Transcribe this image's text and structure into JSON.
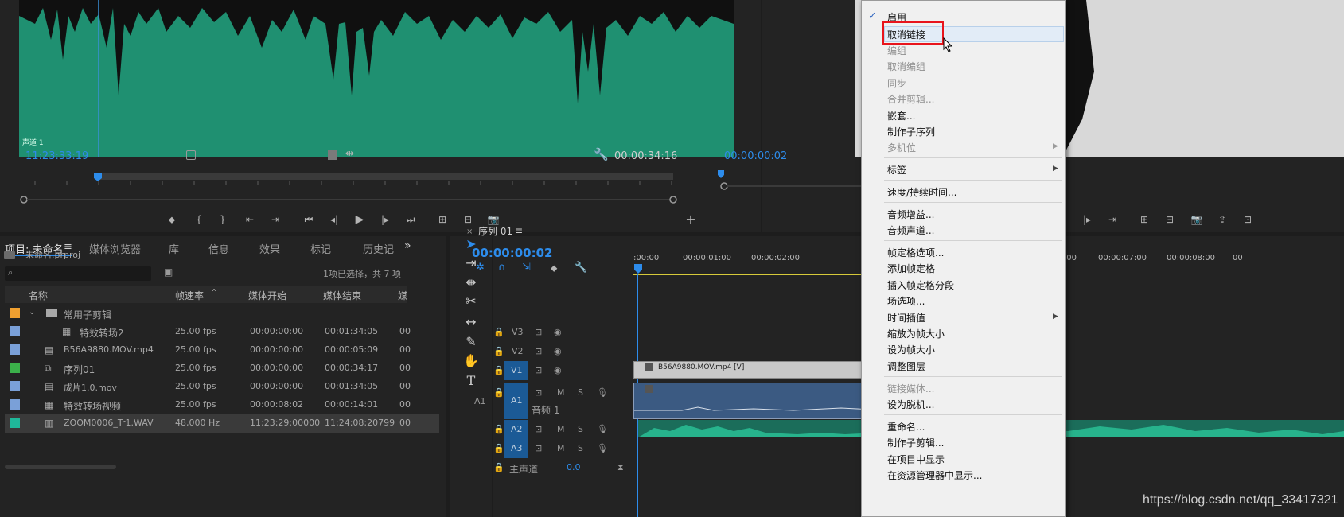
{
  "source_monitor": {
    "channel_label": "声道 1",
    "timecode_in": "11:23:33:19",
    "timecode_duration": "00:00:34:16"
  },
  "program_monitor": {
    "timecode": "00:00:00:02"
  },
  "project_panel": {
    "tabs": [
      "项目: 未命名",
      "媒体浏览器",
      "库",
      "信息",
      "效果",
      "标记",
      "历史记"
    ],
    "project_file": "未命名.prproj",
    "selection_info": "1项已选择，共 7 项",
    "search_placeholder": "",
    "columns": [
      "名称",
      "帧速率",
      "媒体开始",
      "媒体结束",
      "媒"
    ],
    "items": [
      {
        "name": "常用子剪辑",
        "fps": "",
        "start": "",
        "end": "",
        "color": "#f0a030",
        "kind": "folder"
      },
      {
        "name": "特效转场2",
        "fps": "25.00 fps",
        "start": "00:00:00:00",
        "end": "00:01:34:05",
        "color": "#7aa0d8",
        "kind": "clip"
      },
      {
        "name": "B56A9880.MOV.mp4",
        "fps": "25.00 fps",
        "start": "00:00:00:00",
        "end": "00:00:05:09",
        "color": "#7aa0d8",
        "kind": "video"
      },
      {
        "name": "序列01",
        "fps": "25.00 fps",
        "start": "00:00:00:00",
        "end": "00:00:34:17",
        "color": "#3bb04a",
        "kind": "sequence"
      },
      {
        "name": "成片1.0.mov",
        "fps": "25.00 fps",
        "start": "00:00:00:00",
        "end": "00:01:34:05",
        "color": "#7aa0d8",
        "kind": "video"
      },
      {
        "name": "特效转场视频",
        "fps": "25.00 fps",
        "start": "00:00:08:02",
        "end": "00:00:14:01",
        "color": "#7aa0d8",
        "kind": "clip"
      },
      {
        "name": "ZOOM0006_Tr1.WAV",
        "fps": "48,000 Hz",
        "start": "11:23:29:00000",
        "end": "11:24:08:20799",
        "color": "#1fb89a",
        "kind": "audio"
      }
    ],
    "last_col_tail": "00"
  },
  "timeline": {
    "sequence_name": "序列 01",
    "timecode": "00:00:00:02",
    "ruler_labels": [
      ":00:00",
      "00:00:01:00",
      "00:00:02:00",
      "00",
      "00:00:06:00",
      "00:00:07:00",
      "00:00:08:00",
      "00"
    ],
    "tracks": [
      {
        "id": "V3",
        "source": ""
      },
      {
        "id": "V2",
        "source": ""
      },
      {
        "id": "V1",
        "source": ""
      },
      {
        "id": "A1",
        "source": "A1",
        "name": "音频 1"
      },
      {
        "id": "A2",
        "source": ""
      },
      {
        "id": "A3",
        "source": ""
      }
    ],
    "master_label": "主声道",
    "master_value": "0.0",
    "clip_video_label": "B56A9880.MOV.mp4 [V]",
    "mute_label": "M",
    "solo_label": "S"
  },
  "context_menu": {
    "items": [
      {
        "label": "启用",
        "checked": true,
        "disabled": false
      },
      {
        "label": "取消链接",
        "disabled": false,
        "highlighted": true
      },
      {
        "label": "编组",
        "disabled": true
      },
      {
        "label": "取消编组",
        "disabled": true
      },
      {
        "label": "同步",
        "disabled": true
      },
      {
        "label": "合并剪辑...",
        "disabled": true
      },
      {
        "label": "嵌套...",
        "disabled": false
      },
      {
        "label": "制作子序列",
        "disabled": false
      },
      {
        "label": "多机位",
        "disabled": true,
        "submenu": true
      },
      {
        "label": "标签",
        "disabled": false,
        "submenu": true,
        "sep_before": true
      },
      {
        "label": "速度/持续时间...",
        "disabled": false,
        "sep_before": true
      },
      {
        "label": "音频增益...",
        "disabled": false,
        "sep_before": true
      },
      {
        "label": "音频声道...",
        "disabled": false
      },
      {
        "label": "帧定格选项...",
        "disabled": false,
        "sep_before": true
      },
      {
        "label": "添加帧定格",
        "disabled": false
      },
      {
        "label": "插入帧定格分段",
        "disabled": false
      },
      {
        "label": "场选项...",
        "disabled": false
      },
      {
        "label": "时间插值",
        "disabled": false,
        "submenu": true
      },
      {
        "label": "缩放为帧大小",
        "disabled": false
      },
      {
        "label": "设为帧大小",
        "disabled": false
      },
      {
        "label": "调整图层",
        "disabled": false
      },
      {
        "label": "链接媒体...",
        "disabled": true,
        "sep_before": true
      },
      {
        "label": "设为脱机...",
        "disabled": false
      },
      {
        "label": "重命名...",
        "disabled": false,
        "sep_before": true
      },
      {
        "label": "制作子剪辑...",
        "disabled": false
      },
      {
        "label": "在项目中显示",
        "disabled": false
      },
      {
        "label": "在资源管理器中显示...",
        "disabled": false
      }
    ]
  },
  "watermark": "https://blog.csdn.net/qq_33417321",
  "colors": {
    "accent": "#2d8ceb",
    "waveform_bg": "#1f9071",
    "highlight_box": "#e8141c"
  }
}
